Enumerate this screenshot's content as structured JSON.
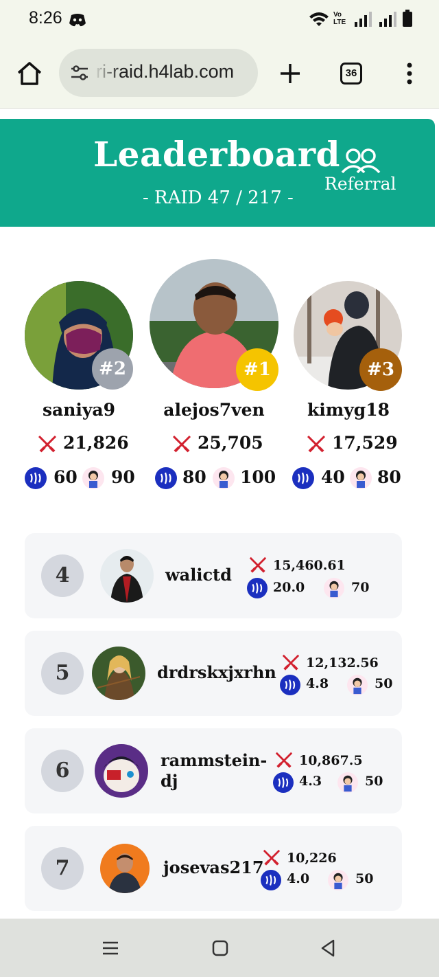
{
  "status": {
    "time": "8:26",
    "network_label": "Vo LTE"
  },
  "browser": {
    "url": "ri-raid.h4lab.com",
    "tab_count": "36"
  },
  "header": {
    "title": "Leaderboard",
    "subtitle": "- RAID 47 / 217 -",
    "referral_label": "Referral"
  },
  "podium": [
    {
      "rank": "#2",
      "name": "saniya9",
      "score": "21,826",
      "steem": "60",
      "bonus": "90",
      "badge_color": "#9da3ad"
    },
    {
      "rank": "#1",
      "name": "alejos7ven",
      "score": "25,705",
      "steem": "80",
      "bonus": "100",
      "badge_color": "#f5c400"
    },
    {
      "rank": "#3",
      "name": "kimyg18",
      "score": "17,529",
      "steem": "40",
      "bonus": "80",
      "badge_color": "#a5600c"
    }
  ],
  "list": [
    {
      "rank": "4",
      "name": "walictd",
      "score": "15,460.61",
      "steem": "20.0",
      "bonus": "70"
    },
    {
      "rank": "5",
      "name": "drdrskxjxrhn",
      "score": "12,132.56",
      "steem": "4.8",
      "bonus": "50"
    },
    {
      "rank": "6",
      "name": "rammstein-dj",
      "score": "10,867.5",
      "steem": "4.3",
      "bonus": "50"
    },
    {
      "rank": "7",
      "name": "josevas217",
      "score": "10,226",
      "steem": "4.0",
      "bonus": "50"
    }
  ],
  "colors": {
    "header_bg": "#0fa88c",
    "coin": "#1b2fbf",
    "sword": "#d2212f"
  }
}
